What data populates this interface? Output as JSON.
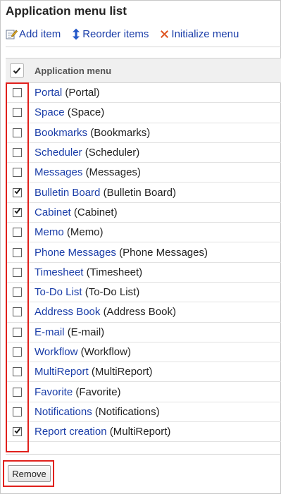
{
  "title": "Application menu list",
  "toolbar": {
    "add_label": "Add item",
    "reorder_label": "Reorder items",
    "initialize_label": "Initialize menu"
  },
  "table": {
    "header_label": "Application menu",
    "header_checked": true,
    "rows": [
      {
        "name": "Portal",
        "paren": "(Portal)",
        "checked": false
      },
      {
        "name": "Space",
        "paren": "(Space)",
        "checked": false
      },
      {
        "name": "Bookmarks",
        "paren": "(Bookmarks)",
        "checked": false
      },
      {
        "name": "Scheduler",
        "paren": "(Scheduler)",
        "checked": false
      },
      {
        "name": "Messages",
        "paren": "(Messages)",
        "checked": false
      },
      {
        "name": "Bulletin Board",
        "paren": "(Bulletin Board)",
        "checked": true
      },
      {
        "name": "Cabinet",
        "paren": "(Cabinet)",
        "checked": true
      },
      {
        "name": "Memo",
        "paren": "(Memo)",
        "checked": false
      },
      {
        "name": "Phone Messages",
        "paren": "(Phone Messages)",
        "checked": false
      },
      {
        "name": "Timesheet",
        "paren": "(Timesheet)",
        "checked": false
      },
      {
        "name": "To-Do List",
        "paren": "(To-Do List)",
        "checked": false
      },
      {
        "name": "Address Book",
        "paren": "(Address Book)",
        "checked": false
      },
      {
        "name": "E-mail",
        "paren": "(E-mail)",
        "checked": false
      },
      {
        "name": "Workflow",
        "paren": "(Workflow)",
        "checked": false
      },
      {
        "name": "MultiReport",
        "paren": "(MultiReport)",
        "checked": false
      },
      {
        "name": "Favorite",
        "paren": "(Favorite)",
        "checked": false
      },
      {
        "name": "Notifications",
        "paren": "(Notifications)",
        "checked": false
      },
      {
        "name": "Report creation",
        "paren": "(MultiReport)",
        "checked": true
      }
    ]
  },
  "remove_label": "Remove",
  "colors": {
    "link": "#1a3da8",
    "highlight": "#e0201c",
    "header_bg": "#f0f0f0"
  },
  "icons": {
    "add": "add-item-icon",
    "reorder": "reorder-icon",
    "initialize": "initialize-x-icon"
  }
}
